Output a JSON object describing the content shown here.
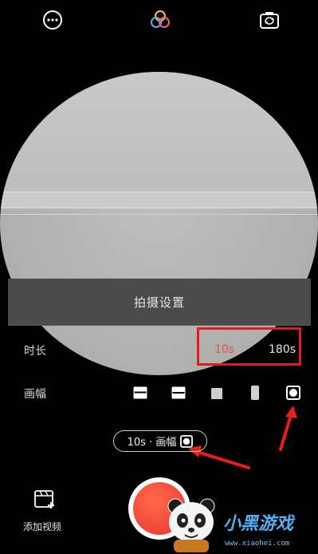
{
  "top_bar": {
    "menu_icon": "more-dots-icon",
    "filter_icon": "color-filter-icon",
    "flip_icon": "camera-flip-icon"
  },
  "settings_panel": {
    "title": "拍摄设置",
    "duration": {
      "label": "时长",
      "options": [
        "10s",
        "180s"
      ],
      "selected": "10s",
      "selected_color": "#e8524a"
    },
    "aspect": {
      "label": "画幅",
      "options": [
        "wide-16-9-icon",
        "wide-4-3-icon",
        "square-1-1-icon",
        "tall-9-16-icon",
        "circle-icon"
      ],
      "selected": "circle-icon"
    }
  },
  "summary_chip": {
    "text": "10s · 画幅"
  },
  "bottom": {
    "add_video_label": "添加视频",
    "record_button_color": "#f24a3a"
  },
  "watermark": {
    "text": "小黑游戏",
    "url": "www.xiaohei.com"
  },
  "colors": {
    "highlight": "#e21c1c",
    "accent": "#e8524a"
  }
}
